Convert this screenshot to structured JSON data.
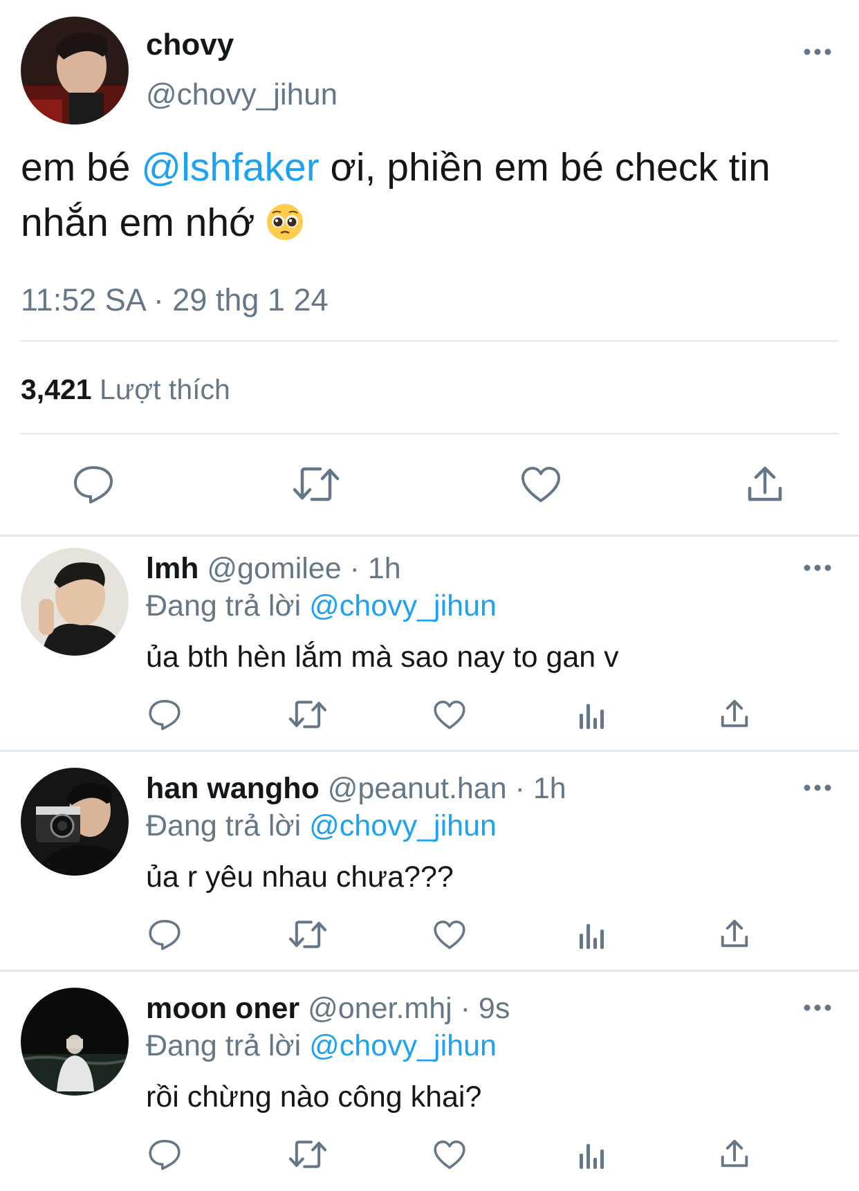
{
  "tweet": {
    "author_name": "chovy",
    "author_handle": "@chovy_jihun",
    "text_before": "em bé ",
    "mention": "@lshfaker",
    "text_after": " ơi, phiền em bé check tin nhắn em nhớ",
    "emoji": "pleading-face-emoji",
    "timestamp": "11:52 SA · 29 thg 1 24",
    "likes_count": "3,421",
    "likes_label": "Lượt thích",
    "actions": [
      "reply-icon",
      "retweet-icon",
      "like-icon",
      "share-icon"
    ]
  },
  "replies": [
    {
      "name": "lmh",
      "meta": " @gomilee · 1h",
      "replying_prefix": "Đang trả lời ",
      "replying_to": "@chovy_jihun",
      "text": "ủa bth hèn lắm mà sao nay to gan v"
    },
    {
      "name": "han wangho",
      "meta": " @peanut.han · 1h",
      "replying_prefix": "Đang trả lời ",
      "replying_to": "@chovy_jihun",
      "text": "ủa r yêu nhau chưa???"
    },
    {
      "name": "moon oner",
      "meta": " @oner.mhj · 9s",
      "replying_prefix": "Đang trả lời ",
      "replying_to": "@chovy_jihun",
      "text": "rồi chừng nào công khai?"
    }
  ],
  "colors": {
    "text": "#14171a",
    "secondary": "#657786",
    "link": "#1da1f2",
    "divider": "#e1e8ed",
    "icon": "#657786"
  }
}
